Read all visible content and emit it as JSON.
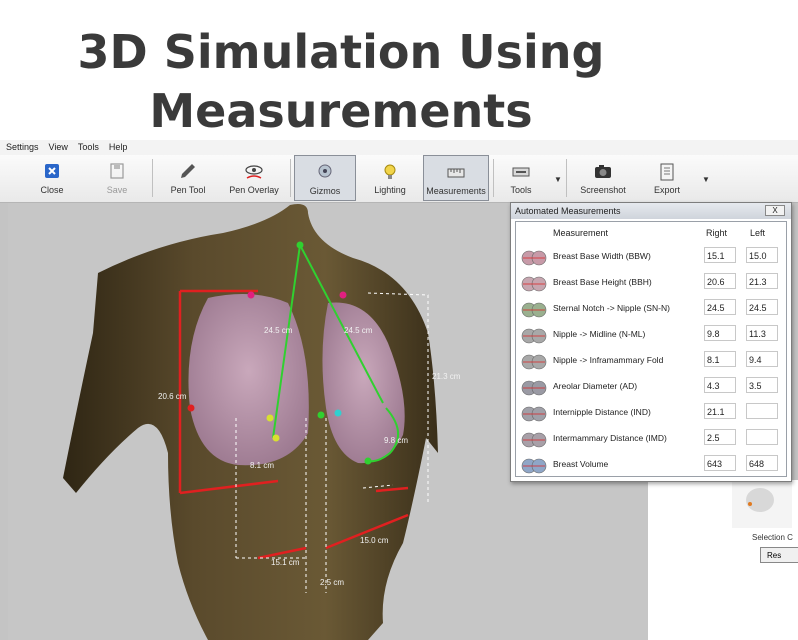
{
  "slide": {
    "title_line1": "3D Simulation Using",
    "title_line2": "Measurements"
  },
  "menu": [
    "Settings",
    "View",
    "Tools",
    "Help"
  ],
  "toolbar": {
    "close": "Close",
    "save": "Save",
    "pen_tool": "Pen Tool",
    "pen_overlay": "Pen Overlay",
    "gizmos": "Gizmos",
    "lighting": "Lighting",
    "measurements": "Measurements",
    "tools": "Tools",
    "screenshot": "Screenshot",
    "export": "Export"
  },
  "overlay_labels": {
    "bbh_right": "20.6 cm",
    "snn_right": "24.5 cm",
    "snn_left": "24.5 cm",
    "nif_right": "8.1 cm",
    "nif_left": "9.8 cm",
    "bbw": "15.1 cm",
    "imd": "2.5 cm",
    "bbw_left": "15.0 cm",
    "bbh_left": "21.3 cm"
  },
  "panel": {
    "title": "Automated Measurements",
    "close_label": "X",
    "col_measurement": "Measurement",
    "col_right": "Right",
    "col_left": "Left",
    "rows": [
      {
        "name": "Breast Base Width (BBW)",
        "right": "15.1",
        "left": "15.0"
      },
      {
        "name": "Breast Base Height (BBH)",
        "right": "20.6",
        "left": "21.3"
      },
      {
        "name": "Sternal Notch -> Nipple (SN-N)",
        "right": "24.5",
        "left": "24.5"
      },
      {
        "name": "Nipple -> Midline (N-ML)",
        "right": "9.8",
        "left": "11.3"
      },
      {
        "name": "Nipple -> Inframammary Fold",
        "right": "8.1",
        "left": "9.4"
      },
      {
        "name": "Areolar Diameter (AD)",
        "right": "4.3",
        "left": "3.5"
      },
      {
        "name": "Internipple Distance (IND)",
        "right": "21.1",
        "left": ""
      },
      {
        "name": "Intermammary Distance (IMD)",
        "right": "2.5",
        "left": ""
      },
      {
        "name": "Breast Volume",
        "right": "643",
        "left": "648"
      }
    ]
  },
  "side": {
    "selection_label": "Selection C",
    "reset_button": "Res"
  },
  "colors": {
    "skin": "#4a3a22",
    "breast": "#b491a5",
    "measure_red": "#e02020",
    "measure_green": "#2fd02f"
  }
}
